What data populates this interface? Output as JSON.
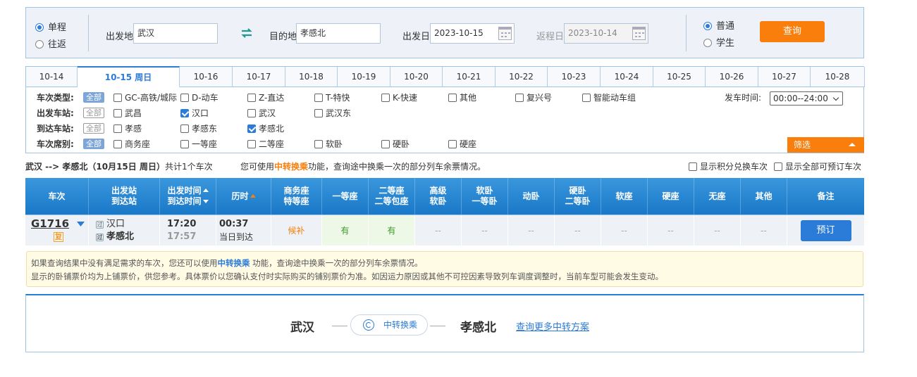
{
  "search": {
    "trip_type": [
      "单程",
      "往返"
    ],
    "from_label": "出发地",
    "from_value": "武汉",
    "to_label": "目的地",
    "to_value": "孝感北",
    "depart_label": "出发日",
    "depart_value": "2023-10-15",
    "return_label": "返程日",
    "return_value": "2023-10-14",
    "passenger_type": [
      "普通",
      "学生"
    ],
    "query_button": "查询"
  },
  "date_tabs": [
    "10-14",
    "10-15 周日",
    "10-16",
    "10-17",
    "10-18",
    "10-19",
    "10-20",
    "10-21",
    "10-22",
    "10-23",
    "10-24",
    "10-25",
    "10-26",
    "10-27",
    "10-28"
  ],
  "filters": {
    "all": "全部",
    "train_type_label": "车次类型:",
    "train_types": [
      "GC-高铁/城际",
      "D-动车",
      "Z-直达",
      "T-特快",
      "K-快速",
      "其他",
      "复兴号",
      "智能动车组"
    ],
    "depart_station_label": "出发车站:",
    "depart_stations": [
      "武昌",
      "汉口",
      "武汉",
      "武汉东"
    ],
    "arrive_station_label": "到达车站:",
    "arrive_stations": [
      "孝感",
      "孝感东",
      "孝感北"
    ],
    "seat_label": "车次席别:",
    "seats": [
      "商务座",
      "一等座",
      "二等座",
      "软卧",
      "硬卧",
      "硬座"
    ],
    "depart_time_label": "发车时间:",
    "depart_time_value": "00:00--24:00",
    "filter_button": "筛选"
  },
  "summary": {
    "route": "武汉 --> 孝感北（10月15日  周日）",
    "count": "共计1个车次",
    "tip_prefix": "您可使用",
    "tip_link": "中转换乘",
    "tip_suffix": "功能，查询途中换乘一次的部分列车余票情况。",
    "show_points": "显示积分兑换车次",
    "show_all": "显示全部可预订车次"
  },
  "table": {
    "headers": [
      [
        "车次"
      ],
      [
        "出发站",
        "到达站"
      ],
      [
        "出发时间",
        "到达时间"
      ],
      [
        "历时"
      ],
      [
        "商务座",
        "特等座"
      ],
      [
        "一等座"
      ],
      [
        "二等座",
        "二等包座"
      ],
      [
        "高级",
        "软卧"
      ],
      [
        "软卧",
        "一等卧"
      ],
      [
        "动卧"
      ],
      [
        "硬卧",
        "二等卧"
      ],
      [
        "软座"
      ],
      [
        "硬座"
      ],
      [
        "无座"
      ],
      [
        "其他"
      ],
      [
        "备注"
      ]
    ],
    "row": {
      "train_no": "G1716",
      "badge": "复",
      "from_mark": "过",
      "from_station": "汉口",
      "to_mark": "过",
      "to_station": "孝感北",
      "depart_time": "17:20",
      "arrive_time": "17:57",
      "duration": "00:37",
      "arrival_day": "当日到达",
      "seats": [
        "候补",
        "有",
        "有",
        "--",
        "--",
        "--",
        "--",
        "--",
        "--",
        "--",
        "--",
        "--"
      ],
      "book_button": "预订"
    }
  },
  "notice": {
    "line1_prefix": "如果查询结果中没有满足需求的车次，您还可以使用",
    "line1_link": "中转换乘",
    "line1_suffix": " 功能，查询途中换乘一次的部分列车余票情况。",
    "line2": "显示的卧铺票价均为上铺票价，供您参考。具体票价以您确认支付时实际购买的铺别票价为准。如因运力原因或其他不可控因素导致列车调度调整时，当前车型可能会发生变动。"
  },
  "transfer": {
    "from": "武汉",
    "pill": "中转换乘",
    "to": "孝感北",
    "more_link": "查询更多中转方案"
  },
  "colors": {
    "accent_blue": "#2b7bd8",
    "accent_orange": "#f97e0c",
    "available_green": "#3c9a2a"
  }
}
